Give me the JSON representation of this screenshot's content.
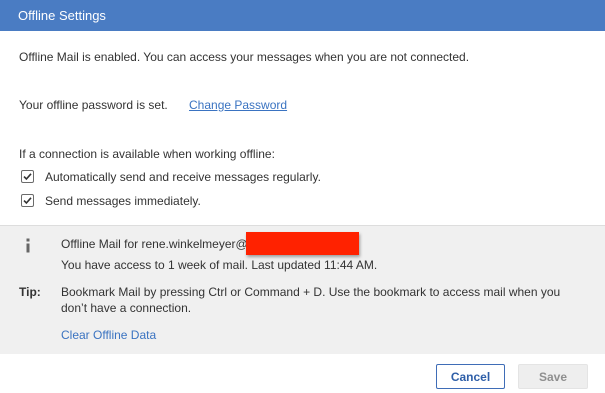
{
  "dialog": {
    "title": "Offline Settings"
  },
  "status": {
    "enabled_text": "Offline Mail is enabled. You can access your messages when you are not connected.",
    "password_text": "Your offline password is set.",
    "change_password_link": "Change Password"
  },
  "connection": {
    "heading": "If a connection is available when working offline:",
    "options": [
      {
        "label": "Automatically send and receive messages regularly.",
        "checked": true
      },
      {
        "label": "Send messages immediately.",
        "checked": true
      }
    ]
  },
  "info": {
    "icon": "info-icon",
    "account_label": "Offline Mail for rene.winkelmeyer@",
    "access_text": "You have access to 1 week of mail. Last updated 11:44 AM.",
    "tip_label": "Tip:",
    "tip_line1": "Bookmark Mail by pressing Ctrl or Command + D. Use the bookmark to access mail when you",
    "tip_line2": "don’t have a connection.",
    "clear_link": "Clear Offline Data"
  },
  "footer": {
    "cancel_label": "Cancel",
    "save_label": "Save",
    "save_enabled": false
  },
  "colors": {
    "titlebar": "#4a7cc3",
    "link": "#3a73c1",
    "panel_bg": "#f0f0f0",
    "redaction": "#ff2200"
  }
}
